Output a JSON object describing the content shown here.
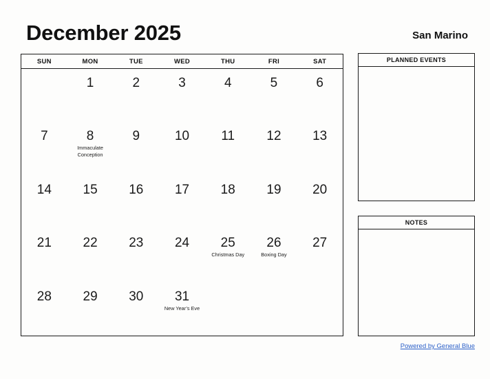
{
  "header": {
    "month_title": "December 2025",
    "region": "San Marino"
  },
  "calendar": {
    "weekday_headers": [
      "SUN",
      "MON",
      "TUE",
      "WED",
      "THU",
      "FRI",
      "SAT"
    ],
    "weeks": [
      [
        {
          "day": "",
          "holiday": ""
        },
        {
          "day": "1",
          "holiday": ""
        },
        {
          "day": "2",
          "holiday": ""
        },
        {
          "day": "3",
          "holiday": ""
        },
        {
          "day": "4",
          "holiday": ""
        },
        {
          "day": "5",
          "holiday": ""
        },
        {
          "day": "6",
          "holiday": ""
        }
      ],
      [
        {
          "day": "7",
          "holiday": ""
        },
        {
          "day": "8",
          "holiday": "Immaculate Conception"
        },
        {
          "day": "9",
          "holiday": ""
        },
        {
          "day": "10",
          "holiday": ""
        },
        {
          "day": "11",
          "holiday": ""
        },
        {
          "day": "12",
          "holiday": ""
        },
        {
          "day": "13",
          "holiday": ""
        }
      ],
      [
        {
          "day": "14",
          "holiday": ""
        },
        {
          "day": "15",
          "holiday": ""
        },
        {
          "day": "16",
          "holiday": ""
        },
        {
          "day": "17",
          "holiday": ""
        },
        {
          "day": "18",
          "holiday": ""
        },
        {
          "day": "19",
          "holiday": ""
        },
        {
          "day": "20",
          "holiday": ""
        }
      ],
      [
        {
          "day": "21",
          "holiday": ""
        },
        {
          "day": "22",
          "holiday": ""
        },
        {
          "day": "23",
          "holiday": ""
        },
        {
          "day": "24",
          "holiday": ""
        },
        {
          "day": "25",
          "holiday": "Christmas Day"
        },
        {
          "day": "26",
          "holiday": "Boxing Day"
        },
        {
          "day": "27",
          "holiday": ""
        }
      ],
      [
        {
          "day": "28",
          "holiday": ""
        },
        {
          "day": "29",
          "holiday": ""
        },
        {
          "day": "30",
          "holiday": ""
        },
        {
          "day": "31",
          "holiday": "New Year’s Eve"
        },
        {
          "day": "",
          "holiday": ""
        },
        {
          "day": "",
          "holiday": ""
        },
        {
          "day": "",
          "holiday": ""
        }
      ]
    ]
  },
  "panels": {
    "planned_events_title": "PLANNED EVENTS",
    "notes_title": "NOTES"
  },
  "footer": {
    "link_text": "Powered by General Blue",
    "link_color": "#2a5fc8"
  }
}
